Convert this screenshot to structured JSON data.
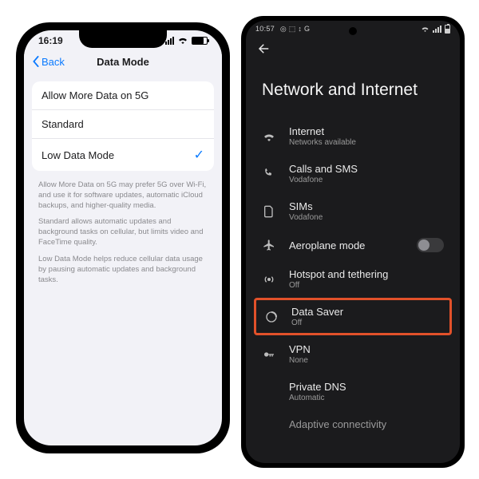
{
  "iphone": {
    "status": {
      "time": "16:19"
    },
    "nav": {
      "back": "Back",
      "title": "Data Mode"
    },
    "options": [
      {
        "label": "Allow More Data on 5G",
        "selected": false
      },
      {
        "label": "Standard",
        "selected": false
      },
      {
        "label": "Low Data Mode",
        "selected": true
      }
    ],
    "footer": {
      "p1": "Allow More Data on 5G may prefer 5G over Wi-Fi, and use it for software updates, automatic iCloud backups, and higher-quality media.",
      "p2": "Standard allows automatic updates and background tasks on cellular, but limits video and FaceTime quality.",
      "p3": "Low Data Mode helps reduce cellular data usage by pausing automatic updates and background tasks."
    }
  },
  "android": {
    "status": {
      "time": "10:57",
      "indicators": "◎ ⬚ ↕ G"
    },
    "title": "Network and Internet",
    "items": [
      {
        "key": "internet",
        "label": "Internet",
        "sub": "Networks available"
      },
      {
        "key": "calls-sms",
        "label": "Calls and SMS",
        "sub": "Vodafone"
      },
      {
        "key": "sims",
        "label": "SIMs",
        "sub": "Vodafone"
      },
      {
        "key": "aeroplane",
        "label": "Aeroplane mode",
        "sub": "",
        "toggle": true
      },
      {
        "key": "hotspot",
        "label": "Hotspot and tethering",
        "sub": "Off"
      },
      {
        "key": "data-saver",
        "label": "Data Saver",
        "sub": "Off",
        "highlight": true
      },
      {
        "key": "vpn",
        "label": "VPN",
        "sub": "None"
      },
      {
        "key": "private-dns",
        "label": "Private DNS",
        "sub": "Automatic"
      },
      {
        "key": "adaptive",
        "label": "Adaptive connectivity",
        "sub": ""
      }
    ]
  }
}
